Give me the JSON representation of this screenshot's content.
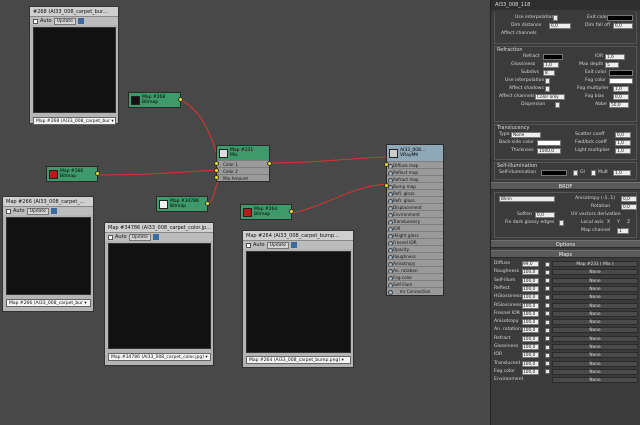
{
  "panel": {
    "title": "AI33_008_118",
    "top": {
      "use_interpolation": "Use interpolation",
      "exit_color": "Exit color",
      "dim_distance": "Dim distance",
      "dim_distance_value": "0,0",
      "dim_fall_off": "Dim fall off",
      "dim_fall_off_value": "0,0",
      "affect_channels": "Affect channels"
    },
    "refraction": {
      "label": "Refraction",
      "refract": "Refract",
      "ior": "IOR",
      "ior_value": "1,6",
      "glossiness": "Glossiness",
      "glossiness_value": "1,0",
      "max_depth": "Max depth",
      "max_depth_value": "5",
      "subdivs": "Subdivs",
      "subdivs_value": "8",
      "exit_color": "Exit color",
      "use_interpolation": "Use interpolation",
      "fog_color": "Fog color",
      "affect_shadows": "Affect shadows",
      "fog_multiplier": "Fog multiplier",
      "fog_multiplier_value": "1,0",
      "affect_channels": "Affect channels",
      "affect_channels_value": "Color only",
      "fog_bias": "Fog bias",
      "fog_bias_value": "0,0",
      "dispersion": "Dispersion",
      "abbe": "Abbe",
      "abbe_value": "50,0"
    },
    "translucency": {
      "label": "Translucency",
      "type": "Type",
      "type_value": "None",
      "scatter_coeff": "Scatter coeff",
      "scatter_coeff_value": "0,0",
      "back_side_color": "Back-side color",
      "fwd_bck_coeff": "Fwd/bck coeff",
      "fwd_bck_coeff_value": "1,0",
      "thickness": "Thickness",
      "thickness_value": "1000,0",
      "light_multiplier": "Light multiplier",
      "light_multiplier_value": "1,0"
    },
    "self_illumination": {
      "label": "Self-illumination",
      "self_illumination": "Self-illumination",
      "gi": "GI",
      "mult": "Mult",
      "mult_value": "1,0"
    },
    "brdf": {
      "label": "BRDF",
      "type_value": "Blinn",
      "anisotropy": "Anisotropy (-1..1)",
      "anisotropy_value": "0,0",
      "rotation": "Rotation",
      "rotation_value": "0,0",
      "soften": "Soften",
      "soften_value": "0,0",
      "uv_vectors": "UV vectors derivation",
      "fix_dark": "Fix dark glossy edges",
      "local_axis": "Local axis",
      "axis_x": "X",
      "axis_y": "Y",
      "axis_z": "Z",
      "map_channel": "Map channel",
      "map_channel_value": "1"
    },
    "options_label": "Options",
    "maps_label": "Maps",
    "maps": [
      {
        "name": "Diffuse",
        "value": "99,0",
        "map": "Map #231 ( Mix )"
      },
      {
        "name": "Roughness",
        "value": "100,0",
        "map": "None"
      },
      {
        "name": "Self-illum",
        "value": "100,0",
        "map": "None"
      },
      {
        "name": "Reflect",
        "value": "100,0",
        "map": "None"
      },
      {
        "name": "HGlossiness",
        "value": "100,0",
        "map": "None"
      },
      {
        "name": "RGlossiness",
        "value": "100,0",
        "map": "None"
      },
      {
        "name": "Fresnel IOR",
        "value": "100,0",
        "map": "None"
      },
      {
        "name": "Anisotropy",
        "value": "100,0",
        "map": "None"
      },
      {
        "name": "An. rotation",
        "value": "100,0",
        "map": "None"
      },
      {
        "name": "Refract",
        "value": "100,0",
        "map": "None"
      },
      {
        "name": "Glossiness",
        "value": "100,0",
        "map": "None"
      },
      {
        "name": "IOR",
        "value": "100,0",
        "map": "None"
      },
      {
        "name": "Translucent",
        "value": "100,0",
        "map": "None"
      },
      {
        "name": "Fog color",
        "value": "100,0",
        "map": "None"
      },
      {
        "name": "Environment",
        "value": "",
        "map": "None"
      }
    ]
  },
  "windows": {
    "w268": {
      "title": "#268 (AI33_008_carpet_bur...",
      "auto": "Auto",
      "update": "Update",
      "select": "Map #268 (AI33_008_carpet_bur ▾"
    },
    "w266": {
      "title": "Map #266 (AI33_008_carpet_...",
      "auto": "Auto",
      "update": "Update",
      "select": "Map #266 (AI33_008_carpet_bur ▾"
    },
    "w34786": {
      "title": "Map #34786 (AI33_008_carpet_color.jp...",
      "auto": "Auto",
      "update": "Update",
      "select": "Map #34786 (AI33_008_carpet_color.jpg) ▾"
    },
    "w264": {
      "title": "Map #264 (AI33_008_carpet_bump...",
      "auto": "Auto",
      "update": "Update",
      "select": "Map #264 (AI33_008_carpet_bump.png) ▾"
    }
  },
  "nodes": {
    "bitmap268": {
      "title": "Map #268",
      "sub": "Bitmap"
    },
    "mix231": {
      "title": "Map #231",
      "sub": "Mix",
      "slots": [
        "Color 1",
        "Color 2",
        "Mix Amount"
      ]
    },
    "bitmap266": {
      "title": "Map #266",
      "sub": "Bitmap"
    },
    "bitmap34786": {
      "title": "Map #34786",
      "sub": "Bitmap"
    },
    "bitmap264": {
      "title": "Map #264",
      "sub": "Bitmap"
    },
    "vray": {
      "title": "AI33_008...",
      "sub": "VRayMtl",
      "slots": [
        "Diffuse map",
        "Reflect map",
        "Refract map",
        "Bump map",
        "Refl. gloss.",
        "Refr. gloss.",
        "Displacement",
        "Environment",
        "Translucency",
        "IOR",
        "Hilight gloss",
        "Fresnel IOR",
        "Opacity",
        "Roughness",
        "Anisotropy",
        "An. rotation",
        "Fog color",
        "Self-illum"
      ],
      "footer": "mr Connection"
    }
  },
  "colors": {
    "node_header": "#3e9a6b",
    "vray_header": "#8fa8b8",
    "wire": "#d8342c",
    "socket": "#e6e020"
  }
}
